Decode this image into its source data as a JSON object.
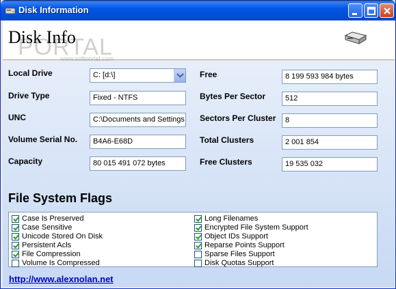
{
  "window": {
    "title": "Disk Information"
  },
  "header": {
    "heading": "Disk Info",
    "watermark": "PORTAL",
    "watermark_url": "www.softportal.com"
  },
  "fields": {
    "local_drive": {
      "label": "Local Drive",
      "value": "C: [d:\\]"
    },
    "drive_type": {
      "label": "Drive Type",
      "value": "Fixed - NTFS"
    },
    "unc": {
      "label": "UNC",
      "value": "C:\\Documents and Settings"
    },
    "volume_serial": {
      "label": "Volume Serial No.",
      "value": "B4A6-E68D"
    },
    "capacity": {
      "label": "Capacity",
      "value": "80 015 491 072 bytes"
    },
    "free": {
      "label": "Free",
      "value": "8 199 593 984 bytes"
    },
    "bytes_per_sector": {
      "label": "Bytes Per Sector",
      "value": "512"
    },
    "sectors_per_cluster": {
      "label": "Sectors Per Cluster",
      "value": "8"
    },
    "total_clusters": {
      "label": "Total Clusters",
      "value": "2 001 854"
    },
    "free_clusters": {
      "label": "Free Clusters",
      "value": "19 535 032"
    }
  },
  "flags": {
    "title": "File System Flags",
    "left": [
      {
        "label": "Case Is Preserved",
        "checked": true
      },
      {
        "label": "Case Sensitive",
        "checked": true
      },
      {
        "label": "Unicode Stored On Disk",
        "checked": true
      },
      {
        "label": "Persistent Acls",
        "checked": true
      },
      {
        "label": "File Compression",
        "checked": true
      },
      {
        "label": "Volume Is Compressed",
        "checked": false
      }
    ],
    "right": [
      {
        "label": "Long Filenames",
        "checked": true
      },
      {
        "label": "Encrypted File System Support",
        "checked": true
      },
      {
        "label": "Object IDs Support",
        "checked": true
      },
      {
        "label": "Reparse Points Support",
        "checked": true
      },
      {
        "label": "Sparse Files Support",
        "checked": false
      },
      {
        "label": "Disk Quotas Support",
        "checked": false
      }
    ]
  },
  "link": {
    "text": "http://www.alexnolan.net"
  }
}
